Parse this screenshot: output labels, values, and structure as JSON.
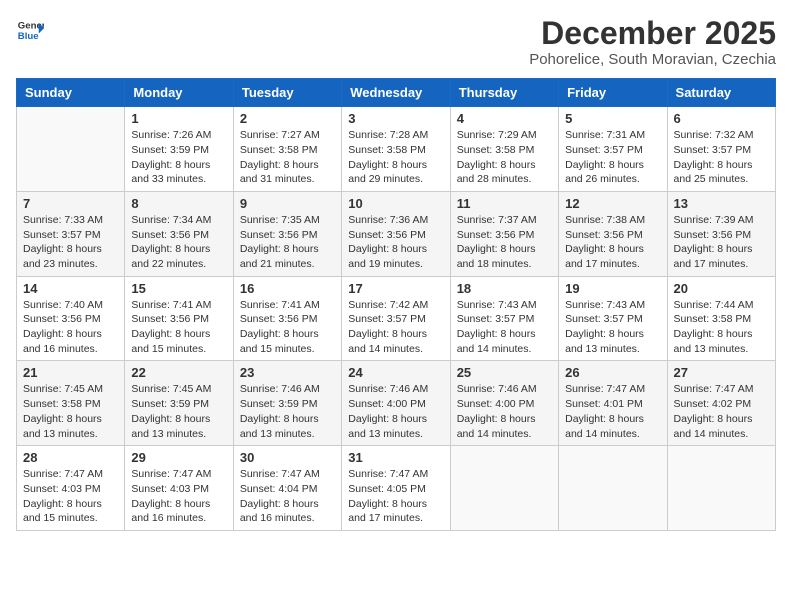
{
  "header": {
    "logo_general": "General",
    "logo_blue": "Blue",
    "month_year": "December 2025",
    "location": "Pohorelice, South Moravian, Czechia"
  },
  "weekdays": [
    "Sunday",
    "Monday",
    "Tuesday",
    "Wednesday",
    "Thursday",
    "Friday",
    "Saturday"
  ],
  "weeks": [
    [
      {
        "day": "",
        "info": ""
      },
      {
        "day": "1",
        "info": "Sunrise: 7:26 AM\nSunset: 3:59 PM\nDaylight: 8 hours\nand 33 minutes."
      },
      {
        "day": "2",
        "info": "Sunrise: 7:27 AM\nSunset: 3:58 PM\nDaylight: 8 hours\nand 31 minutes."
      },
      {
        "day": "3",
        "info": "Sunrise: 7:28 AM\nSunset: 3:58 PM\nDaylight: 8 hours\nand 29 minutes."
      },
      {
        "day": "4",
        "info": "Sunrise: 7:29 AM\nSunset: 3:58 PM\nDaylight: 8 hours\nand 28 minutes."
      },
      {
        "day": "5",
        "info": "Sunrise: 7:31 AM\nSunset: 3:57 PM\nDaylight: 8 hours\nand 26 minutes."
      },
      {
        "day": "6",
        "info": "Sunrise: 7:32 AM\nSunset: 3:57 PM\nDaylight: 8 hours\nand 25 minutes."
      }
    ],
    [
      {
        "day": "7",
        "info": "Sunrise: 7:33 AM\nSunset: 3:57 PM\nDaylight: 8 hours\nand 23 minutes."
      },
      {
        "day": "8",
        "info": "Sunrise: 7:34 AM\nSunset: 3:56 PM\nDaylight: 8 hours\nand 22 minutes."
      },
      {
        "day": "9",
        "info": "Sunrise: 7:35 AM\nSunset: 3:56 PM\nDaylight: 8 hours\nand 21 minutes."
      },
      {
        "day": "10",
        "info": "Sunrise: 7:36 AM\nSunset: 3:56 PM\nDaylight: 8 hours\nand 19 minutes."
      },
      {
        "day": "11",
        "info": "Sunrise: 7:37 AM\nSunset: 3:56 PM\nDaylight: 8 hours\nand 18 minutes."
      },
      {
        "day": "12",
        "info": "Sunrise: 7:38 AM\nSunset: 3:56 PM\nDaylight: 8 hours\nand 17 minutes."
      },
      {
        "day": "13",
        "info": "Sunrise: 7:39 AM\nSunset: 3:56 PM\nDaylight: 8 hours\nand 17 minutes."
      }
    ],
    [
      {
        "day": "14",
        "info": "Sunrise: 7:40 AM\nSunset: 3:56 PM\nDaylight: 8 hours\nand 16 minutes."
      },
      {
        "day": "15",
        "info": "Sunrise: 7:41 AM\nSunset: 3:56 PM\nDaylight: 8 hours\nand 15 minutes."
      },
      {
        "day": "16",
        "info": "Sunrise: 7:41 AM\nSunset: 3:56 PM\nDaylight: 8 hours\nand 15 minutes."
      },
      {
        "day": "17",
        "info": "Sunrise: 7:42 AM\nSunset: 3:57 PM\nDaylight: 8 hours\nand 14 minutes."
      },
      {
        "day": "18",
        "info": "Sunrise: 7:43 AM\nSunset: 3:57 PM\nDaylight: 8 hours\nand 14 minutes."
      },
      {
        "day": "19",
        "info": "Sunrise: 7:43 AM\nSunset: 3:57 PM\nDaylight: 8 hours\nand 13 minutes."
      },
      {
        "day": "20",
        "info": "Sunrise: 7:44 AM\nSunset: 3:58 PM\nDaylight: 8 hours\nand 13 minutes."
      }
    ],
    [
      {
        "day": "21",
        "info": "Sunrise: 7:45 AM\nSunset: 3:58 PM\nDaylight: 8 hours\nand 13 minutes."
      },
      {
        "day": "22",
        "info": "Sunrise: 7:45 AM\nSunset: 3:59 PM\nDaylight: 8 hours\nand 13 minutes."
      },
      {
        "day": "23",
        "info": "Sunrise: 7:46 AM\nSunset: 3:59 PM\nDaylight: 8 hours\nand 13 minutes."
      },
      {
        "day": "24",
        "info": "Sunrise: 7:46 AM\nSunset: 4:00 PM\nDaylight: 8 hours\nand 13 minutes."
      },
      {
        "day": "25",
        "info": "Sunrise: 7:46 AM\nSunset: 4:00 PM\nDaylight: 8 hours\nand 14 minutes."
      },
      {
        "day": "26",
        "info": "Sunrise: 7:47 AM\nSunset: 4:01 PM\nDaylight: 8 hours\nand 14 minutes."
      },
      {
        "day": "27",
        "info": "Sunrise: 7:47 AM\nSunset: 4:02 PM\nDaylight: 8 hours\nand 14 minutes."
      }
    ],
    [
      {
        "day": "28",
        "info": "Sunrise: 7:47 AM\nSunset: 4:03 PM\nDaylight: 8 hours\nand 15 minutes."
      },
      {
        "day": "29",
        "info": "Sunrise: 7:47 AM\nSunset: 4:03 PM\nDaylight: 8 hours\nand 16 minutes."
      },
      {
        "day": "30",
        "info": "Sunrise: 7:47 AM\nSunset: 4:04 PM\nDaylight: 8 hours\nand 16 minutes."
      },
      {
        "day": "31",
        "info": "Sunrise: 7:47 AM\nSunset: 4:05 PM\nDaylight: 8 hours\nand 17 minutes."
      },
      {
        "day": "",
        "info": ""
      },
      {
        "day": "",
        "info": ""
      },
      {
        "day": "",
        "info": ""
      }
    ]
  ]
}
